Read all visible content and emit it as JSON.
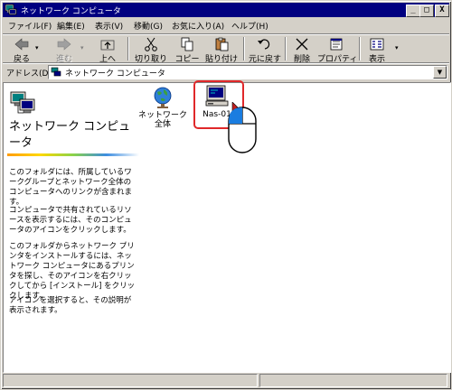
{
  "window": {
    "title": "ネットワーク コンピュータ"
  },
  "title_buttons": {
    "minimize": "_",
    "maximize": "□",
    "close": "X"
  },
  "menu": [
    "ファイル(F)",
    "編集(E)",
    "表示(V)",
    "移動(G)",
    "お気に入り(A)",
    "ヘルプ(H)"
  ],
  "toolbar": {
    "back": "戻る",
    "forward": "進む",
    "up": "上へ",
    "cut": "切り取り",
    "copy": "コピー",
    "paste": "貼り付け",
    "undo": "元に戻す",
    "delete": "削除",
    "properties": "プロパティ",
    "views": "表示"
  },
  "address": {
    "label": "アドレス(D)",
    "value": "ネットワーク コンピュータ"
  },
  "left_pane": {
    "title": "ネットワーク コンピュータ",
    "paragraphs": [
      "このフォルダには、所属しているワークグループとネットワーク全体のコンピュータへのリンクが含まれます。",
      "コンピュータで共有されているリソースを表示するには、そのコンピュータのアイコンをクリックします。",
      "このフォルダからネットワーク プリンタをインストールするには、ネットワーク コンピュータにあるプリンタを探し、そのアイコンを右クリックしてから [インストール] をクリックします。",
      "アイコンを選択すると、その説明が表示されます。"
    ]
  },
  "items": [
    {
      "label": "ネットワーク全体",
      "icon": "globe-icon"
    },
    {
      "label": "Nas-01",
      "icon": "computer-icon"
    }
  ],
  "colors": {
    "titlebar": "#000080",
    "highlight": "#e0282a",
    "face": "#d4d0c8"
  }
}
